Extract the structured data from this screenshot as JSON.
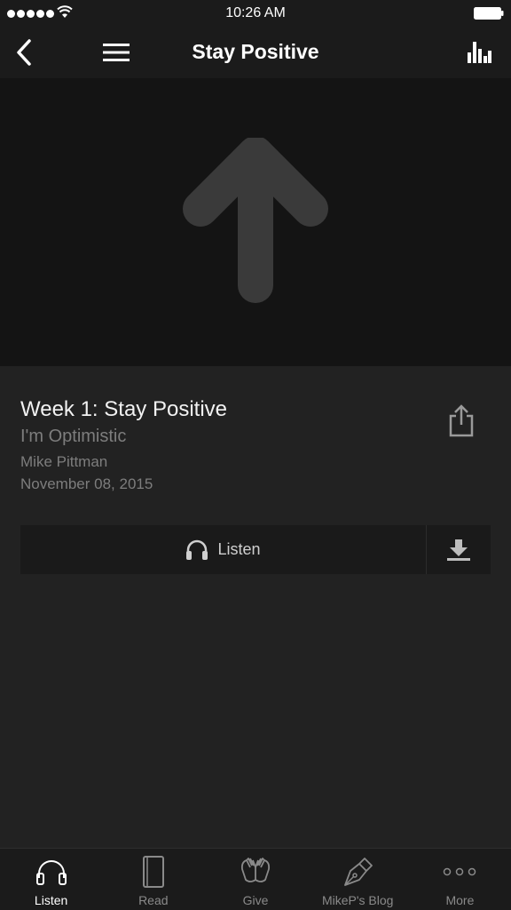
{
  "status_bar": {
    "time": "10:26 AM"
  },
  "nav": {
    "title": "Stay Positive"
  },
  "episode": {
    "title": "Week 1: Stay Positive",
    "subtitle": "I'm Optimistic",
    "speaker": "Mike Pittman",
    "date": "November 08, 2015"
  },
  "actions": {
    "listen_label": "Listen"
  },
  "tabs": [
    {
      "label": "Listen",
      "icon": "headphones-icon",
      "active": true
    },
    {
      "label": "Read",
      "icon": "book-icon",
      "active": false
    },
    {
      "label": "Give",
      "icon": "giving-hands-icon",
      "active": false
    },
    {
      "label": "MikeP's Blog",
      "icon": "pen-nib-icon",
      "active": false
    },
    {
      "label": "More",
      "icon": "more-dots-icon",
      "active": false
    }
  ],
  "colors": {
    "background": "#222222",
    "header": "#1b1b1b",
    "artwork_bg": "#141414",
    "arrow": "#3a3a3a",
    "muted_text": "#7d7d7d"
  }
}
